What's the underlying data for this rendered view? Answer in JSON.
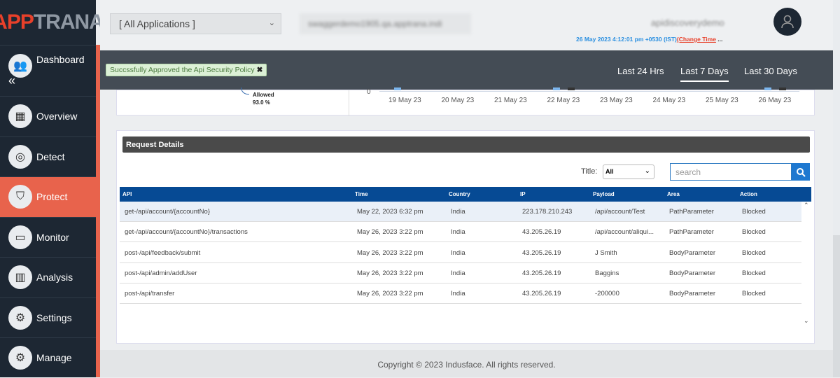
{
  "logo": {
    "part1": "APP",
    "part2": "TRANA"
  },
  "sidebar": {
    "items": [
      {
        "label": "Dashboard",
        "icon": "dashboard-icon"
      },
      {
        "label": "Overview",
        "icon": "overview-icon"
      },
      {
        "label": "Detect",
        "icon": "target-icon"
      },
      {
        "label": "Protect",
        "icon": "shield-icon",
        "active": true
      },
      {
        "label": "Monitor",
        "icon": "monitor-icon"
      },
      {
        "label": "Analysis",
        "icon": "bar-chart-icon"
      },
      {
        "label": "Settings",
        "icon": "gear-icon"
      },
      {
        "label": "Manage",
        "icon": "cog-icon"
      }
    ],
    "collapse": "«"
  },
  "header": {
    "app_select": "[ All Applications ]",
    "domain": "swaggerdemo1905.qa.apptrana.indi",
    "user": "apidiscoverydemo",
    "time": "26 May 2023 4:12:01 pm +0530 (IST)",
    "change_time": "(Change Time",
    "dots": "..."
  },
  "toast": {
    "message": "Succssfully Approved the Api Security Policy",
    "close": "✖"
  },
  "ranges": [
    "Last 24 Hrs",
    "Last 7 Days",
    "Last 30 Days"
  ],
  "selected_range": "Last 7 Days",
  "chart": {
    "allowed_label": "Allowed",
    "allowed_value": "93.0 %",
    "y_zero": "0",
    "dates": [
      "19 May 23",
      "20 May 23",
      "21 May 23",
      "22 May 23",
      "23 May 23",
      "24 May 23",
      "25 May 23",
      "26 May 23"
    ],
    "colors": {
      "blue": "#7cb5ec",
      "dark": "#333333"
    }
  },
  "request": {
    "title": "Request Details",
    "filter_label": "Title:",
    "filter_value": "All",
    "search_placeholder": "search",
    "columns": [
      "API",
      "Time",
      "Country",
      "IP",
      "Payload",
      "Area",
      "Action"
    ],
    "rows": [
      [
        "get-/api/account/{accountNo}",
        "May 22, 2023 6:32 pm",
        "India",
        "223.178.210.243",
        "/api/account/Test",
        "PathParameter",
        "Blocked"
      ],
      [
        "get-/api/account/{accountNo}/transactions",
        "May 26, 2023 3:22 pm",
        "India",
        "43.205.26.19",
        "/api/account/aliqui...",
        "PathParameter",
        "Blocked"
      ],
      [
        "post-/api/feedback/submit",
        "May 26, 2023 3:22 pm",
        "India",
        "43.205.26.19",
        "J Smith",
        "BodyParameter",
        "Blocked"
      ],
      [
        "post-/api/admin/addUser",
        "May 26, 2023 3:22 pm",
        "India",
        "43.205.26.19",
        "Baggins",
        "BodyParameter",
        "Blocked"
      ],
      [
        "post-/api/transfer",
        "May 26, 2023 3:22 pm",
        "India",
        "43.205.26.19",
        "-200000",
        "BodyParameter",
        "Blocked"
      ]
    ]
  },
  "footer": "Copyright © 2023 Indusface. All rights reserved."
}
